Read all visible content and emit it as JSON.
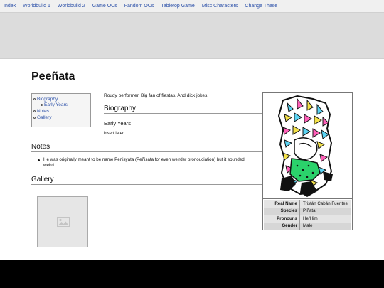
{
  "nav": {
    "items": [
      "Index",
      "Worldbuild 1",
      "Worldbuild 2",
      "Game OCs",
      "Fandom OCs",
      "Tabletop Game",
      "Misc Characters",
      "Change These"
    ]
  },
  "page": {
    "title": "Peeñata",
    "intro": "Roudy performer. Big fan of fiestas. And dick jokes."
  },
  "toc": {
    "biography": "Biography",
    "early_years": "Early Years",
    "notes": "Notes",
    "gallery": "Gallery"
  },
  "sections": {
    "biography": {
      "heading": "Biography",
      "early_years_heading": "Early Years",
      "early_years_text": "insert later"
    },
    "notes": {
      "heading": "Notes",
      "items": [
        "He was originally meant to be name Penisyata (Peñisata for even weirder pronouciation) but it sounded weird."
      ]
    },
    "gallery": {
      "heading": "Gallery"
    }
  },
  "infobox": {
    "rows": [
      {
        "label": "Real Name",
        "value": "Tristán Cabán Fuentes"
      },
      {
        "label": "Species",
        "value": "Piñata"
      },
      {
        "label": "Pronouns",
        "value": "He/Him"
      },
      {
        "label": "Gender",
        "value": "Male"
      }
    ]
  },
  "colors": {
    "link": "#2a4fa8",
    "banner": "#dcdcdc",
    "nav_bg": "#f0f0f0",
    "infobox_row": "#e4e4e4"
  },
  "icons": {
    "gallery_thumb": "image-placeholder-icon"
  }
}
